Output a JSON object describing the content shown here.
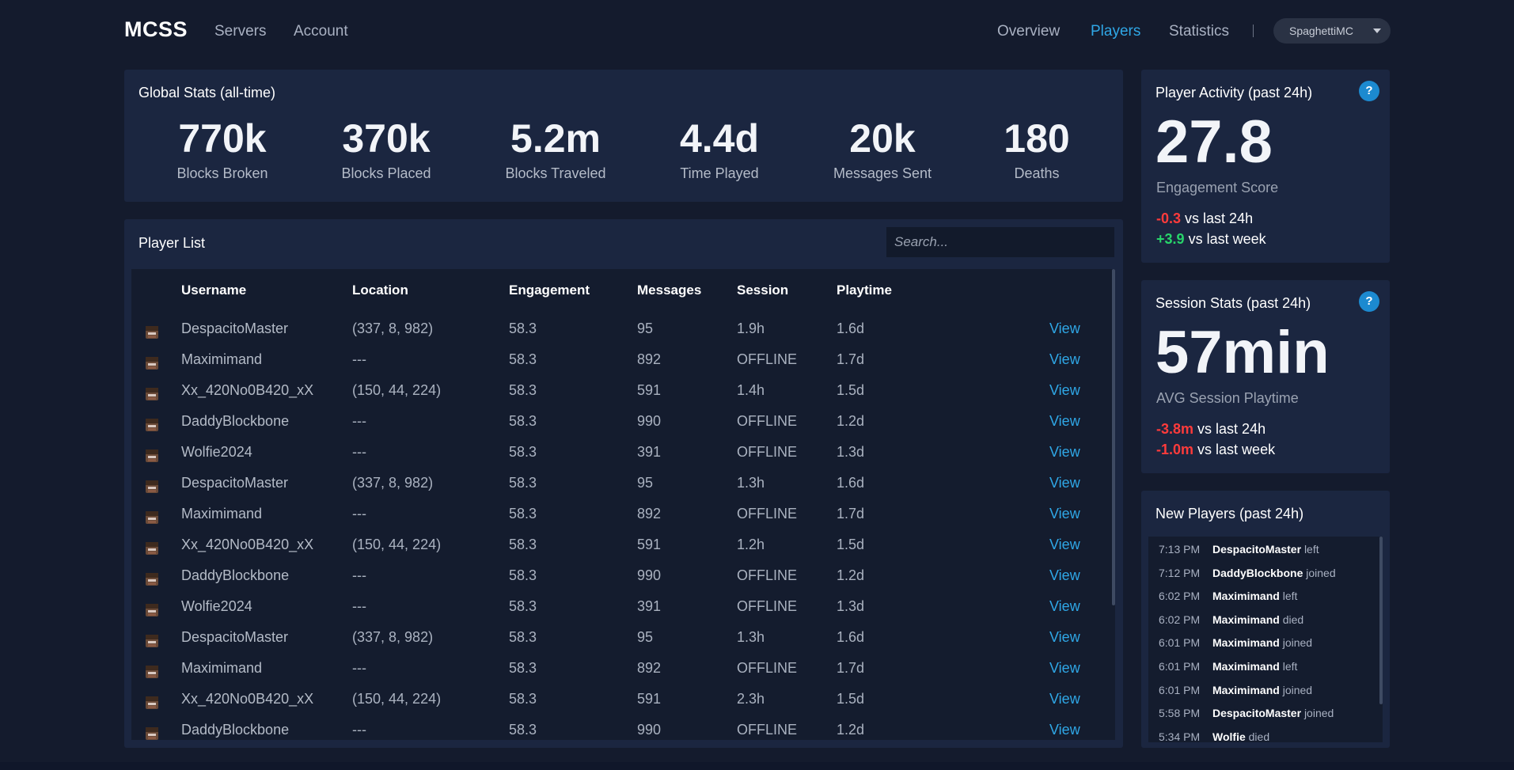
{
  "nav": {
    "brand": "MCSS",
    "left_links": [
      "Servers",
      "Account"
    ],
    "right_links": [
      "Overview",
      "Players",
      "Statistics"
    ],
    "active": "Players",
    "server_select": "SpaghettiMC"
  },
  "global_stats": {
    "title": "Global Stats (all-time)",
    "items": [
      {
        "value": "770k",
        "label": "Blocks Broken"
      },
      {
        "value": "370k",
        "label": "Blocks Placed"
      },
      {
        "value": "5.2m",
        "label": "Blocks Traveled"
      },
      {
        "value": "4.4d",
        "label": "Time Played"
      },
      {
        "value": "20k",
        "label": "Messages Sent"
      },
      {
        "value": "180",
        "label": "Deaths"
      }
    ]
  },
  "player_list": {
    "title": "Player List",
    "search_placeholder": "Search...",
    "columns": [
      "Username",
      "Location",
      "Engagement",
      "Messages",
      "Session",
      "Playtime"
    ],
    "view_label": "View",
    "rows": [
      {
        "username": "DespacitoMaster",
        "location": "(337, 8, 982)",
        "engagement": "58.3",
        "messages": "95",
        "session": "1.9h",
        "playtime": "1.6d"
      },
      {
        "username": "Maximimand",
        "location": "---",
        "engagement": "58.3",
        "messages": "892",
        "session": "OFFLINE",
        "playtime": "1.7d"
      },
      {
        "username": "Xx_420No0B420_xX",
        "location": "(150, 44, 224)",
        "engagement": "58.3",
        "messages": "591",
        "session": "1.4h",
        "playtime": "1.5d"
      },
      {
        "username": "DaddyBlockbone",
        "location": "---",
        "engagement": "58.3",
        "messages": "990",
        "session": "OFFLINE",
        "playtime": "1.2d"
      },
      {
        "username": "Wolfie2024",
        "location": "---",
        "engagement": "58.3",
        "messages": "391",
        "session": "OFFLINE",
        "playtime": "1.3d"
      },
      {
        "username": "DespacitoMaster",
        "location": "(337, 8, 982)",
        "engagement": "58.3",
        "messages": "95",
        "session": "1.3h",
        "playtime": "1.6d"
      },
      {
        "username": "Maximimand",
        "location": "---",
        "engagement": "58.3",
        "messages": "892",
        "session": "OFFLINE",
        "playtime": "1.7d"
      },
      {
        "username": "Xx_420No0B420_xX",
        "location": "(150, 44, 224)",
        "engagement": "58.3",
        "messages": "591",
        "session": "1.2h",
        "playtime": "1.5d"
      },
      {
        "username": "DaddyBlockbone",
        "location": "---",
        "engagement": "58.3",
        "messages": "990",
        "session": "OFFLINE",
        "playtime": "1.2d"
      },
      {
        "username": "Wolfie2024",
        "location": "---",
        "engagement": "58.3",
        "messages": "391",
        "session": "OFFLINE",
        "playtime": "1.3d"
      },
      {
        "username": "DespacitoMaster",
        "location": "(337, 8, 982)",
        "engagement": "58.3",
        "messages": "95",
        "session": "1.3h",
        "playtime": "1.6d"
      },
      {
        "username": "Maximimand",
        "location": "---",
        "engagement": "58.3",
        "messages": "892",
        "session": "OFFLINE",
        "playtime": "1.7d"
      },
      {
        "username": "Xx_420No0B420_xX",
        "location": "(150, 44, 224)",
        "engagement": "58.3",
        "messages": "591",
        "session": "2.3h",
        "playtime": "1.5d"
      },
      {
        "username": "DaddyBlockbone",
        "location": "---",
        "engagement": "58.3",
        "messages": "990",
        "session": "OFFLINE",
        "playtime": "1.2d"
      }
    ]
  },
  "player_activity": {
    "title": "Player Activity (past 24h)",
    "help": "?",
    "value": "27.8",
    "label": "Engagement Score",
    "delta_day": {
      "value": "-0.3",
      "text": "vs last 24h"
    },
    "delta_week": {
      "value": "+3.9",
      "text": "vs last week"
    }
  },
  "session_stats": {
    "title": "Session Stats (past 24h)",
    "help": "?",
    "value": "57min",
    "label": "AVG Session Playtime",
    "delta_day": {
      "value": "-3.8m",
      "text": "vs last 24h"
    },
    "delta_week": {
      "value": "-1.0m",
      "text": "vs last week"
    }
  },
  "new_players": {
    "title": "New Players (past 24h)",
    "events": [
      {
        "time": "7:13 PM",
        "name": "DespacitoMaster",
        "action": "left"
      },
      {
        "time": "7:12 PM",
        "name": "DaddyBlockbone",
        "action": "joined"
      },
      {
        "time": "6:02 PM",
        "name": "Maximimand",
        "action": "left"
      },
      {
        "time": "6:02 PM",
        "name": "Maximimand",
        "action": "died"
      },
      {
        "time": "6:01 PM",
        "name": "Maximimand",
        "action": "joined"
      },
      {
        "time": "6:01 PM",
        "name": "Maximimand",
        "action": "left"
      },
      {
        "time": "6:01 PM",
        "name": "Maximimand",
        "action": "joined"
      },
      {
        "time": "5:58 PM",
        "name": "DespacitoMaster",
        "action": "joined"
      },
      {
        "time": "5:34 PM",
        "name": "Wolfie",
        "action": "died"
      }
    ]
  },
  "colors": {
    "background": "#141b2d",
    "panel": "#1b2640",
    "accent": "#2fa7e6",
    "negative": "#ff3b3b",
    "positive": "#28d46a"
  }
}
